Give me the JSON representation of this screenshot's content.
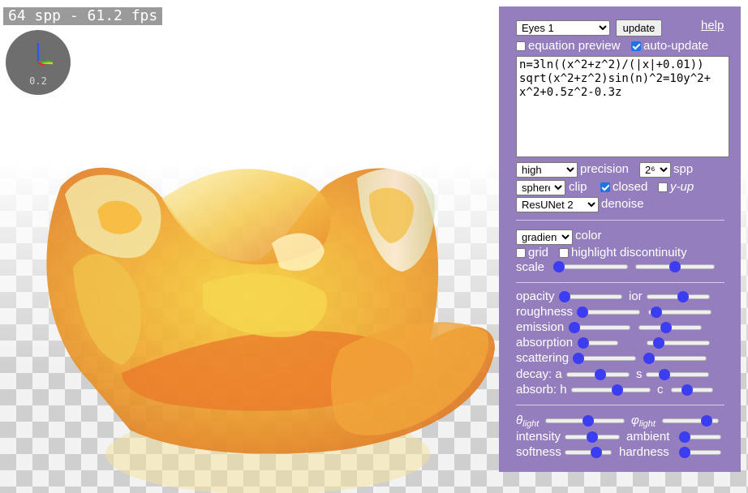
{
  "viewport": {
    "fps_label": "64 spp - 61.2 fps",
    "gizmo_scale": "0.2"
  },
  "panel": {
    "preset": {
      "selected": "Eyes 1"
    },
    "update_label": "update",
    "help_label": "help",
    "equation_preview": {
      "label": "equation preview",
      "checked": false
    },
    "auto_update": {
      "label": "auto-update",
      "checked": true
    },
    "expression": "n=3ln((x^2+z^2)/(|x|+0.01))\nsqrt(x^2+z^2)sin(n)^2=10y^2+\nx^2+0.5z^2-0.3z",
    "precision": {
      "selected": "high",
      "label": "precision"
    },
    "spp": {
      "selected": "2⁶",
      "label": "spp"
    },
    "clip": {
      "selected": "sphere",
      "label": "clip"
    },
    "closed": {
      "label": "closed",
      "checked": true
    },
    "y_up": {
      "label": "y-up",
      "checked": false
    },
    "denoise": {
      "selected": "ResUNet 2",
      "label": "denoise"
    },
    "color": {
      "selected": "gradient",
      "label": "color"
    },
    "grid": {
      "label": "grid",
      "checked": false
    },
    "highlight_discontinuity": {
      "label": "highlight discontinuity",
      "checked": false
    },
    "scale": {
      "label": "scale",
      "values": [
        0.0,
        0.5
      ]
    },
    "opacity": {
      "label": "opacity",
      "value": 0.0
    },
    "ior": {
      "label": "ior",
      "value": 0.6
    },
    "roughness": {
      "label": "roughness",
      "value": 0.0
    },
    "roughness2": {
      "value": 0.05
    },
    "emission": {
      "label": "emission",
      "value": 0.0
    },
    "emission2": {
      "value": 0.42
    },
    "absorption": {
      "label": "absorption",
      "value": 0.0
    },
    "absorption2": {
      "value": 0.12
    },
    "scattering": {
      "label": "scattering",
      "value": 0.0
    },
    "scattering2": {
      "value": 0.0
    },
    "decay_a": {
      "label": "decay: a",
      "value": 0.55
    },
    "decay_s": {
      "label": "s",
      "value": 0.25
    },
    "absorb_h": {
      "label": "absorb: h",
      "value": 0.6
    },
    "absorb_c": {
      "label": "c",
      "value": 0.35
    },
    "theta_light": {
      "label_main": "θ",
      "label_sub": "light",
      "value": 0.55
    },
    "phi_light": {
      "label_main": "φ",
      "label_sub": "light",
      "value": 0.85
    },
    "intensity": {
      "label": "intensity",
      "value": 0.5
    },
    "ambient": {
      "label": "ambient",
      "value": 0.0
    },
    "softness": {
      "label": "softness",
      "value": 0.72
    },
    "hardness": {
      "label": "hardness",
      "value": 0.0
    }
  },
  "colors": {
    "panel_bg": "#957ebd",
    "slider_thumb": "#3c3cf0",
    "checkbox_on": "#1a73e8"
  }
}
